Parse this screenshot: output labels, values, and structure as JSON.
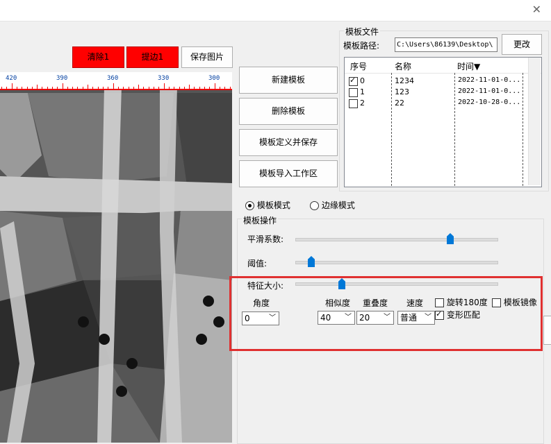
{
  "window": {
    "close_glyph": "✕"
  },
  "toolbar": {
    "clear_label": "清除1",
    "extract_label": "提边1",
    "save_image_label": "保存图片"
  },
  "ruler": {
    "ticks": [
      "420",
      "390",
      "360",
      "330",
      "300"
    ]
  },
  "template_buttons": {
    "new": "新建模板",
    "delete": "删除模板",
    "define_save": "模板定义并保存",
    "import": "模板导入工作区"
  },
  "template_file": {
    "group_title": "模板文件",
    "path_label": "模板路径:",
    "path_value": "C:\\Users\\86139\\Desktop\\",
    "change_label": "更改"
  },
  "table": {
    "headers": [
      "序号",
      "名称",
      "时间▼"
    ],
    "rows": [
      {
        "checked": true,
        "index": "0",
        "name": "1234",
        "time": "2022-11-01-0..."
      },
      {
        "checked": false,
        "index": "1",
        "name": "123",
        "time": "2022-11-01-0..."
      },
      {
        "checked": false,
        "index": "2",
        "name": "22",
        "time": "2022-10-28-0..."
      }
    ]
  },
  "mode": {
    "template_mode": "模板模式",
    "edge_mode": "边缘模式",
    "selected": "template"
  },
  "operation": {
    "group_title": "模板操作",
    "smooth_label": "平滑系数:",
    "threshold_label": "阈值:",
    "feature_size_label": "特征大小:",
    "smooth_level": 0.77,
    "threshold_level": 0.08,
    "feature_size_level": 0.23
  },
  "params": {
    "angle_label": "角度",
    "angle_value": "0",
    "similarity_label": "相似度",
    "similarity_value": "40",
    "overlap_label": "重叠度",
    "overlap_value": "20",
    "speed_label": "速度",
    "speed_value": "普通",
    "rotate_label": "旋转180度",
    "rotate_checked": false,
    "mirror_label": "模板镜像",
    "mirror_checked": false,
    "deform_label": "变形匹配",
    "deform_checked": true
  },
  "colors": {
    "highlight": "#e03030",
    "red_button": "#ff0000",
    "slider": "#0078d7"
  }
}
